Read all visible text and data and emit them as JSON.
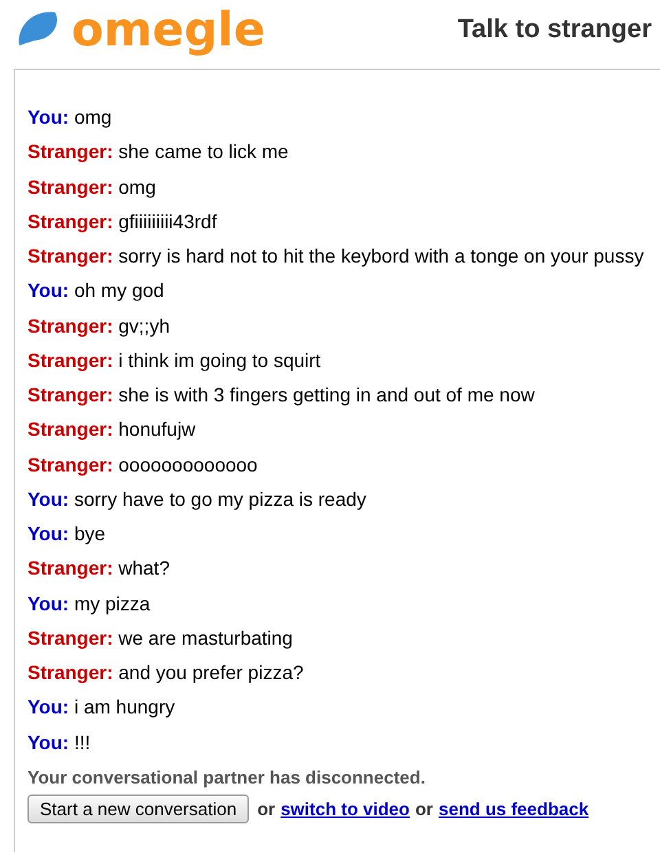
{
  "header": {
    "logo": "omegle",
    "tagline": "Talk to stranger"
  },
  "messages": [
    {
      "kind": "you",
      "speaker": "You:",
      "text": "omg"
    },
    {
      "kind": "stranger",
      "speaker": "Stranger:",
      "text": "she came to lick me"
    },
    {
      "kind": "stranger",
      "speaker": "Stranger:",
      "text": "omg"
    },
    {
      "kind": "stranger",
      "speaker": "Stranger:",
      "text": "gfiiiiiiiii43rdf"
    },
    {
      "kind": "stranger",
      "speaker": "Stranger:",
      "text": "sorry is hard not to hit the keybord with a tonge on your pussy"
    },
    {
      "kind": "you",
      "speaker": "You:",
      "text": "oh my god"
    },
    {
      "kind": "stranger",
      "speaker": "Stranger:",
      "text": "gv;;yh"
    },
    {
      "kind": "stranger",
      "speaker": "Stranger:",
      "text": "i think im going to squirt"
    },
    {
      "kind": "stranger",
      "speaker": "Stranger:",
      "text": "she is with 3 fingers getting in and out of me now"
    },
    {
      "kind": "stranger",
      "speaker": "Stranger:",
      "text": "honufujw"
    },
    {
      "kind": "stranger",
      "speaker": "Stranger:",
      "text": "ooooooooooooo"
    },
    {
      "kind": "you",
      "speaker": "You:",
      "text": "sorry have to go my pizza is ready"
    },
    {
      "kind": "you",
      "speaker": "You:",
      "text": "bye"
    },
    {
      "kind": "stranger",
      "speaker": "Stranger:",
      "text": "what?"
    },
    {
      "kind": "you",
      "speaker": "You:",
      "text": "my pizza"
    },
    {
      "kind": "stranger",
      "speaker": "Stranger:",
      "text": "we are masturbating"
    },
    {
      "kind": "stranger",
      "speaker": "Stranger:",
      "text": "and you prefer pizza?"
    },
    {
      "kind": "you",
      "speaker": "You:",
      "text": "i am hungry"
    },
    {
      "kind": "you",
      "speaker": "You:",
      "text": "!!!"
    }
  ],
  "status": "Your conversational partner has disconnected.",
  "actions": {
    "button": "Start a new conversation",
    "or_1": "or",
    "link_1": "switch to video",
    "or_2": "or",
    "link_2": "send us feedback"
  }
}
